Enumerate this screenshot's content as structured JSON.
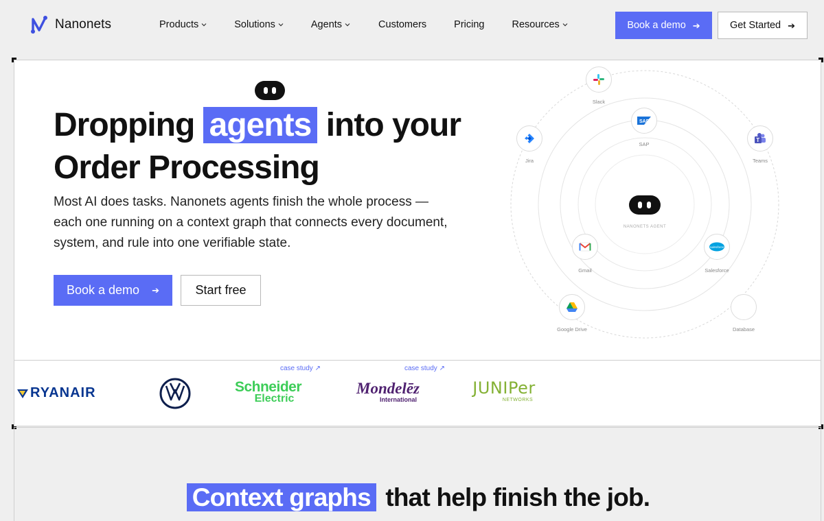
{
  "brand": {
    "name": "Nanonets",
    "accent": "#5a6cf5"
  },
  "nav": {
    "items": [
      {
        "label": "Products",
        "dropdown": true
      },
      {
        "label": "Solutions",
        "dropdown": true
      },
      {
        "label": "Agents",
        "dropdown": true
      },
      {
        "label": "Customers",
        "dropdown": false
      },
      {
        "label": "Pricing",
        "dropdown": false
      },
      {
        "label": "Resources",
        "dropdown": true
      }
    ],
    "demo_label": "Book a demo",
    "start_label": "Get Started"
  },
  "hero": {
    "title_pre": "Dropping",
    "title_highlight": "agents",
    "title_post": "into your",
    "title_line2": "Order Processing",
    "subtitle": "Most AI does tasks. Nanonets agents finish the whole process — each one running on a context graph that connects every document, system, and rule into one verifiable state.",
    "demo_label": "Book a demo",
    "free_label": "Start free"
  },
  "graph": {
    "center_label": "NANONETS AGENT",
    "nodes": [
      {
        "name": "slack",
        "label": "Slack"
      },
      {
        "name": "sap",
        "label": "SAP"
      },
      {
        "name": "jira",
        "label": "Jira"
      },
      {
        "name": "teams",
        "label": "Teams"
      },
      {
        "name": "gmail",
        "label": "Gmail"
      },
      {
        "name": "salesforce",
        "label": "Salesforce",
        "logo_text": "salesforce"
      },
      {
        "name": "google-drive",
        "label": "Google Drive"
      },
      {
        "name": "database",
        "label": "Database"
      }
    ]
  },
  "logos": {
    "case_label": "case study ↗",
    "items": [
      {
        "name": "ryanair",
        "text": "RYANAIR"
      },
      {
        "name": "volkswagen",
        "text": "VW"
      },
      {
        "name": "schneider",
        "text_line1": "Schneider",
        "text_line2": "Electric"
      },
      {
        "name": "mondelez",
        "text_line1": "Mondelēz",
        "text_line2": "International"
      },
      {
        "name": "juniper",
        "text_line1": "JUNIPer",
        "text_line2": "NETWORKS"
      }
    ]
  },
  "section2": {
    "title_highlight": "Context graphs",
    "title_rest": "that help finish the job."
  }
}
